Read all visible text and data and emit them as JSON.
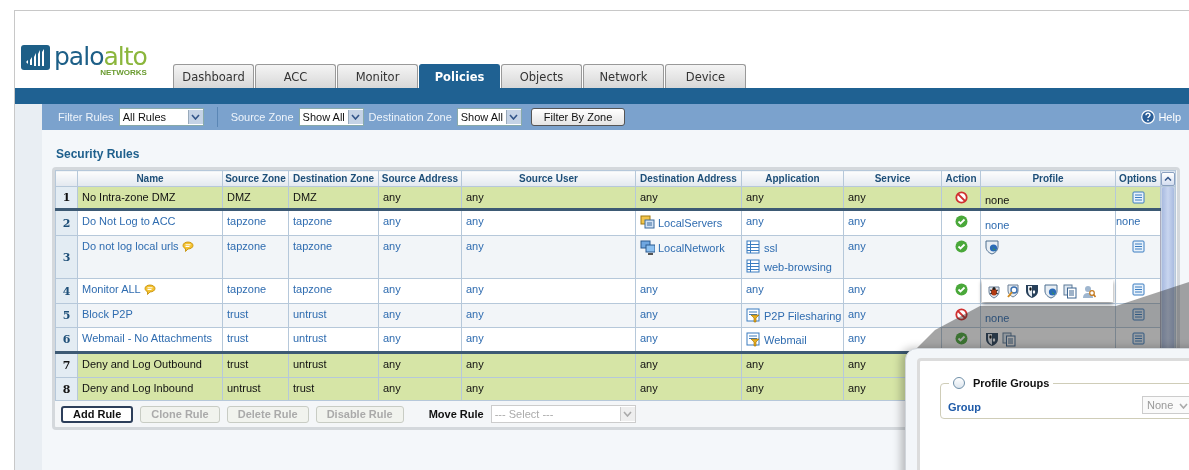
{
  "logo": {
    "wordmark": [
      "palo",
      "alto"
    ],
    "subtitle": "NETWORKS"
  },
  "tabs": [
    {
      "label": "Dashboard",
      "selected": false
    },
    {
      "label": "ACC",
      "selected": false
    },
    {
      "label": "Monitor",
      "selected": false
    },
    {
      "label": "Policies",
      "selected": true
    },
    {
      "label": "Objects",
      "selected": false
    },
    {
      "label": "Network",
      "selected": false
    },
    {
      "label": "Device",
      "selected": false
    }
  ],
  "filter_bar": {
    "filter_label": "Filter Rules",
    "filter_value": "All Rules",
    "source_label": "Source Zone",
    "source_value": "Show All",
    "dest_label": "Destination Zone",
    "dest_value": "Show All",
    "button": "Filter By Zone",
    "help": "Help"
  },
  "section_title": "Security Rules",
  "table": {
    "columns": [
      "Name",
      "Source Zone",
      "Destination Zone",
      "Source Address",
      "Source User",
      "Destination Address",
      "Application",
      "Service",
      "Action",
      "Profile",
      "Options"
    ],
    "rows": [
      {
        "number": "1",
        "shaded": true,
        "name": "No Intra-zone DMZ",
        "comment": false,
        "source_zone": "DMZ",
        "dest_zone": "DMZ",
        "source_address": "any",
        "source_user": "any",
        "dest_address": [
          {
            "text": "any",
            "kind": "plain"
          }
        ],
        "application": [
          {
            "text": "any",
            "kind": "plain"
          }
        ],
        "service": "any",
        "action": {
          "kind": "deny"
        },
        "profile": {
          "kind": "text",
          "text": "none"
        },
        "options": {
          "kind": "icon"
        }
      },
      {
        "number": "2",
        "shaded": false,
        "name": "Do Not Log to ACC",
        "comment": false,
        "source_zone": "tapzone",
        "dest_zone": "tapzone",
        "source_address": "any",
        "source_user": "any",
        "dest_address": [
          {
            "text": "LocalServers",
            "kind": "servers"
          }
        ],
        "application": [
          {
            "text": "any",
            "kind": "plain"
          }
        ],
        "service": "any",
        "action": {
          "kind": "allow"
        },
        "profile": {
          "kind": "text",
          "text": "none"
        },
        "options": {
          "kind": "text",
          "text": "none"
        }
      },
      {
        "number": "3",
        "shaded": false,
        "name": "Do not log local urls",
        "comment": true,
        "source_zone": "tapzone",
        "dest_zone": "tapzone",
        "source_address": "any",
        "source_user": "any",
        "dest_address": [
          {
            "text": "LocalNetwork",
            "kind": "computers"
          }
        ],
        "application": [
          {
            "text": "ssl",
            "kind": "app"
          },
          {
            "text": "web-browsing",
            "kind": "app"
          }
        ],
        "service": "any",
        "action": {
          "kind": "allow"
        },
        "profile": {
          "kind": "icons",
          "icons": [
            {
              "kind": "url"
            }
          ]
        },
        "options": {
          "kind": "icon"
        }
      },
      {
        "number": "4",
        "shaded": false,
        "name": "Monitor ALL",
        "comment": true,
        "source_zone": "tapzone",
        "dest_zone": "tapzone",
        "source_address": "any",
        "source_user": "any",
        "dest_address": [
          {
            "text": "any",
            "kind": "plain"
          }
        ],
        "application": [
          {
            "text": "any",
            "kind": "plain"
          }
        ],
        "service": "any",
        "action": {
          "kind": "allow"
        },
        "profile": {
          "kind": "popup",
          "icons": [
            {
              "kind": "virus"
            },
            {
              "kind": "spyware"
            },
            {
              "kind": "vulnerability"
            },
            {
              "kind": "url"
            },
            {
              "kind": "file"
            },
            {
              "kind": "data"
            }
          ]
        },
        "options": {
          "kind": "icon"
        }
      },
      {
        "number": "5",
        "shaded": false,
        "name": "Block P2P",
        "comment": false,
        "source_zone": "trust",
        "dest_zone": "untrust",
        "source_address": "any",
        "source_user": "any",
        "dest_address": [
          {
            "text": "any",
            "kind": "plain"
          }
        ],
        "application": [
          {
            "text": "P2P Filesharing",
            "kind": "filter"
          }
        ],
        "service": "any",
        "action": {
          "kind": "deny"
        },
        "profile": {
          "kind": "text",
          "text": "none"
        },
        "options": {
          "kind": "icon"
        }
      },
      {
        "number": "6",
        "shaded": false,
        "name": "Webmail - No Attachments",
        "comment": false,
        "source_zone": "trust",
        "dest_zone": "untrust",
        "source_address": "any",
        "source_user": "any",
        "dest_address": [
          {
            "text": "any",
            "kind": "plain"
          }
        ],
        "application": [
          {
            "text": "Webmail",
            "kind": "filter"
          }
        ],
        "service": "any",
        "action": {
          "kind": "allow"
        },
        "profile": {
          "kind": "icons",
          "icons": [
            {
              "kind": "vulnerability"
            },
            {
              "kind": "file"
            }
          ]
        },
        "options": {
          "kind": "icon"
        }
      },
      {
        "number": "7",
        "shaded": true,
        "name": "Deny and Log Outbound",
        "comment": false,
        "source_zone": "trust",
        "dest_zone": "untrust",
        "source_address": "any",
        "source_user": "any",
        "dest_address": [
          {
            "text": "any",
            "kind": "plain"
          }
        ],
        "application": [
          {
            "text": "any",
            "kind": "plain"
          }
        ],
        "service": "any",
        "profile": {
          "kind": "none"
        },
        "options": {
          "kind": "none"
        }
      },
      {
        "number": "8",
        "shaded": true,
        "name": "Deny and Log Inbound",
        "comment": false,
        "source_zone": "untrust",
        "dest_zone": "trust",
        "source_address": "any",
        "source_user": "any",
        "dest_address": [
          {
            "text": "any",
            "kind": "plain"
          }
        ],
        "application": [
          {
            "text": "any",
            "kind": "plain"
          }
        ],
        "service": "any",
        "profile": {
          "kind": "none"
        },
        "options": {
          "kind": "none"
        }
      }
    ]
  },
  "actions": [
    {
      "label": "Add Rule",
      "disabled": false
    },
    {
      "label": "Clone Rule",
      "disabled": true
    },
    {
      "label": "Delete Rule",
      "disabled": true
    },
    {
      "label": "Disable Rule",
      "disabled": true
    }
  ],
  "move_rule": {
    "label": "Move Rule",
    "placeholder": "--- Select ---",
    "disabled": true
  },
  "magnified_dialog": {
    "group_title": "Profile Groups",
    "selected": false,
    "field_label": "Group",
    "field_value": "None",
    "field_disabled": true
  }
}
